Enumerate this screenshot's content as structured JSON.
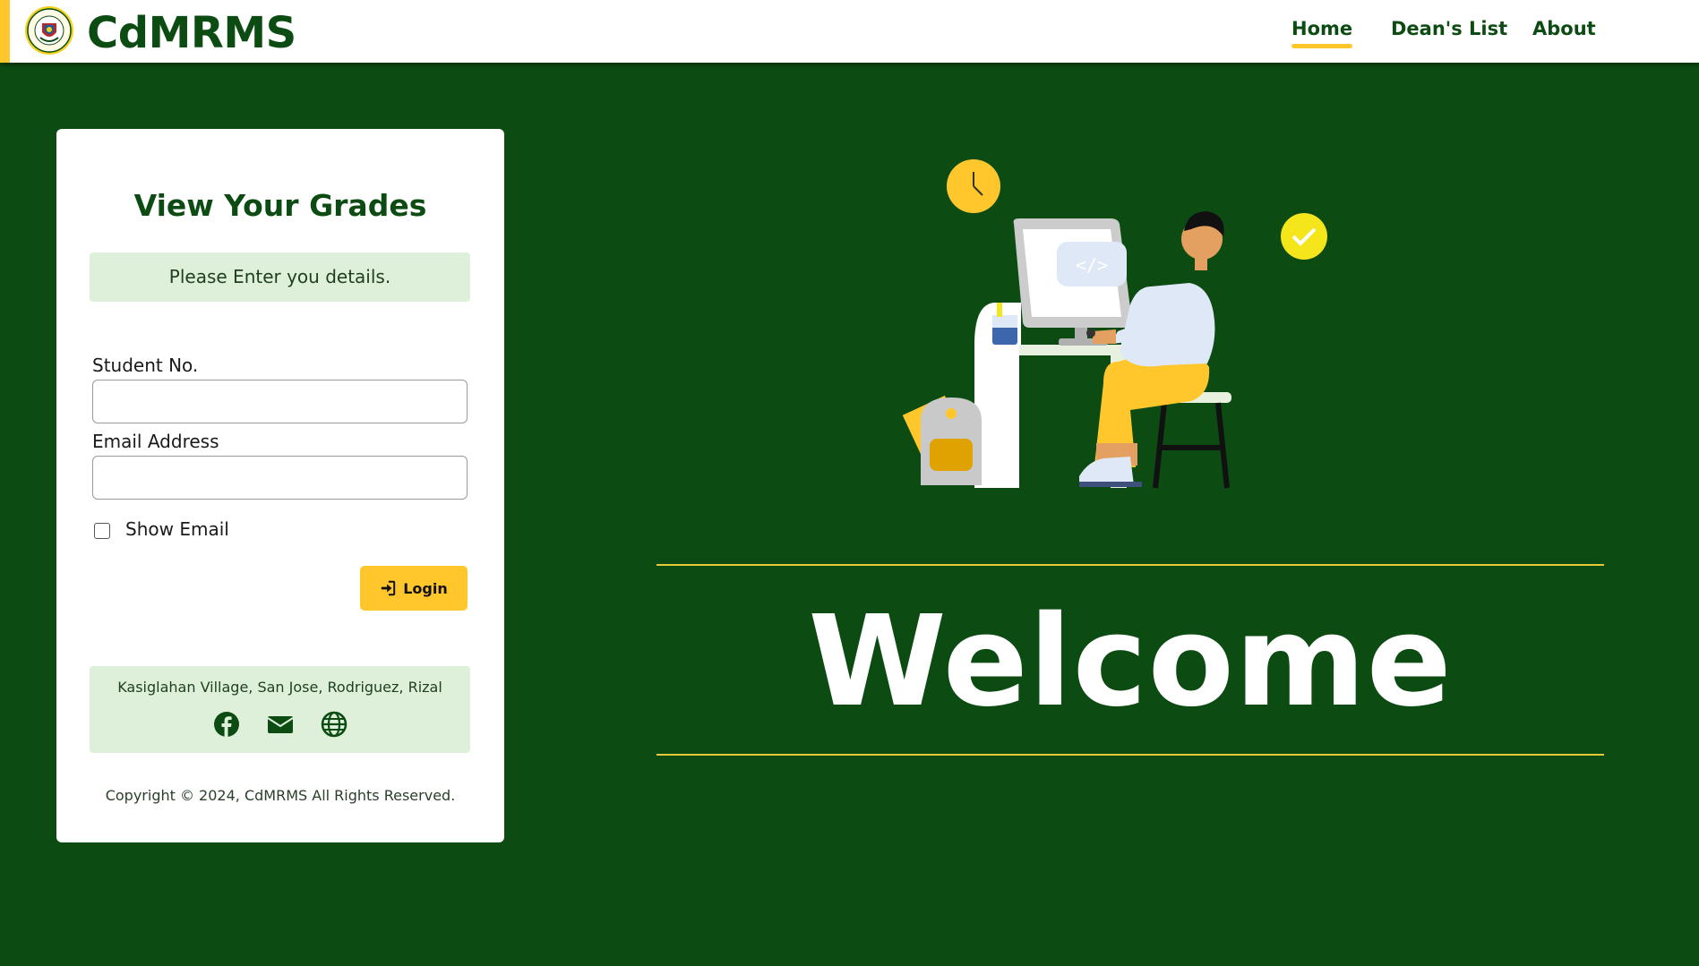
{
  "header": {
    "brand": "CdMRMS",
    "logo_icon": "college-seal-logo",
    "nav": [
      {
        "label": "Home",
        "active": true
      },
      {
        "label": "Dean's List",
        "active": false
      },
      {
        "label": "About",
        "active": false
      }
    ]
  },
  "login_card": {
    "title": "View Your Grades",
    "notice": "Please Enter you details.",
    "student_label": "Student No.",
    "student_value": "",
    "email_label": "Email Address",
    "email_value": "",
    "show_email_label": "Show Email",
    "show_email_checked": false,
    "login_label": "Login",
    "login_icon": "sign-in-icon",
    "address": "Kasiglahan Village, San Jose, Rodriguez, Rizal",
    "social_icons": [
      "facebook-icon",
      "envelope-icon",
      "globe-icon"
    ],
    "copyright": "Copyright © 2024, CdMRMS All Rights Reserved."
  },
  "hero": {
    "welcome": "Welcome",
    "illustration": "person-at-computer-illustration"
  },
  "colors": {
    "brand_green": "#0c4b12",
    "accent_yellow": "#ffc72c",
    "light_green": "#dff0da",
    "white": "#ffffff"
  }
}
